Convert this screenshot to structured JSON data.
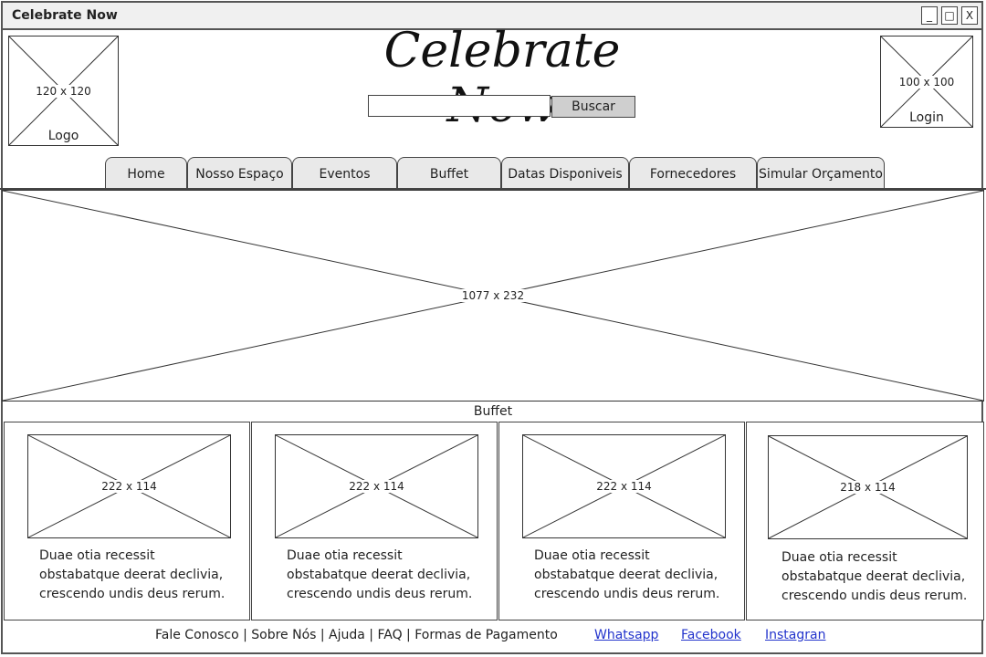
{
  "window": {
    "title": "Celebrate Now",
    "controls": [
      "_",
      "□",
      "X"
    ]
  },
  "header": {
    "brand": "Celebrate Now",
    "logo": {
      "dim": "120 x 120",
      "caption": "Logo"
    },
    "login": {
      "dim": "100 x 100",
      "caption": "Login"
    },
    "search": {
      "value": "",
      "button_label": "Buscar"
    }
  },
  "nav": {
    "tabs": [
      {
        "label": "Home"
      },
      {
        "label": "Nosso Espaço"
      },
      {
        "label": "Eventos"
      },
      {
        "label": "Buffet"
      },
      {
        "label": "Datas Disponiveis"
      },
      {
        "label": "Fornecedores"
      },
      {
        "label": "Simular Orçamento"
      }
    ]
  },
  "banner": {
    "dim": "1077 x 232"
  },
  "section": {
    "title": "Buffet",
    "cards": [
      {
        "dim": "222 x 114",
        "lines": [
          "Duae otia recessit",
          "obstabatque deerat declivia,",
          "crescendo undis deus rerum."
        ]
      },
      {
        "dim": "222 x 114",
        "lines": [
          "Duae otia recessit",
          "obstabatque deerat declivia,",
          "crescendo undis deus rerum."
        ]
      },
      {
        "dim": "222 x 114",
        "lines": [
          "Duae otia recessit",
          "obstabatque deerat declivia,",
          "crescendo undis deus rerum."
        ]
      },
      {
        "dim": "218 x 114",
        "lines": [
          "Duae otia recessit",
          "obstabatque deerat declivia,",
          "crescendo undis deus rerum."
        ]
      }
    ]
  },
  "footer": {
    "text": "Fale Conosco | Sobre Nós | Ajuda | FAQ | Formas de Pagamento",
    "links": [
      "Whatsapp",
      "Facebook",
      "Instagran"
    ],
    "link_color": "#2233cc"
  }
}
